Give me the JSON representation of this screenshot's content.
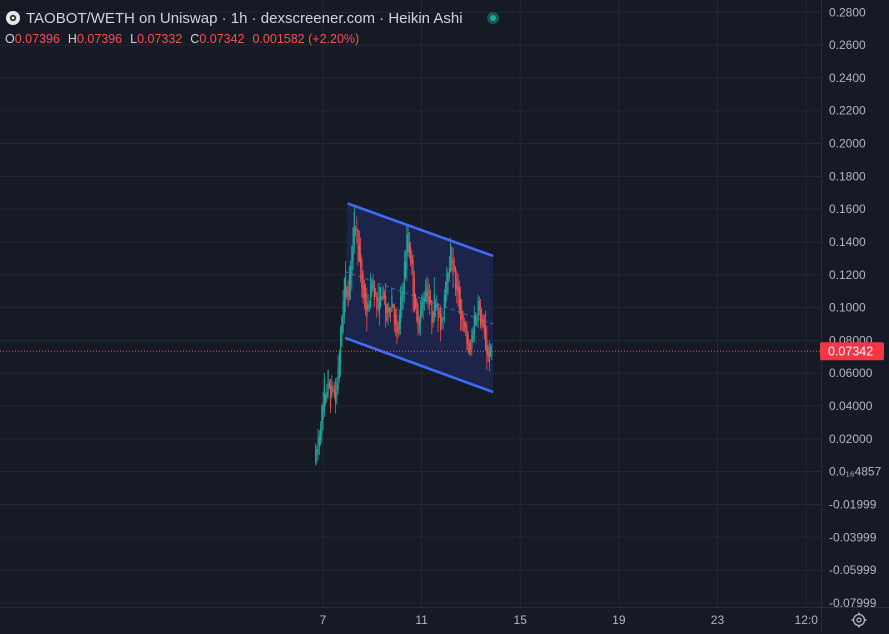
{
  "header": {
    "title": "TAOBOT/WETH on Uniswap · 1h · dexscreener.com · Heikin Ashi"
  },
  "ohlc": {
    "o_label": "O",
    "o_value": "0.07396",
    "h_label": "H",
    "h_value": "0.07396",
    "l_label": "L",
    "l_value": "0.07332",
    "c_label": "C",
    "c_value": "0.07342",
    "change": "0.001582 (+2.20%)"
  },
  "colors": {
    "background": "#161a25",
    "grid": "#232734",
    "up": "#26a69a",
    "down": "#ef5350",
    "channel_line": "#3f6bff",
    "channel_fill": "#1f2a55",
    "price_label_bg": "#f23645"
  },
  "chart_data": {
    "type": "candlestick",
    "chart_style": "Heikin Ashi",
    "y_ticks": [
      "0.2800",
      "0.2600",
      "0.2400",
      "0.2200",
      "0.2000",
      "0.1800",
      "0.1600",
      "0.1400",
      "0.1200",
      "0.1000",
      "0.08000",
      "0.06000",
      "0.04000",
      "0.02000",
      "0.0₁₆4857",
      "-0.01999",
      "-0.03999",
      "-0.05999",
      "-0.07999"
    ],
    "y_tick_values": [
      0.28,
      0.26,
      0.24,
      0.22,
      0.2,
      0.18,
      0.16,
      0.14,
      0.12,
      0.1,
      0.08,
      0.06,
      0.04,
      0.02,
      0.0,
      -0.02,
      -0.04,
      -0.06,
      -0.08
    ],
    "ylim": [
      -0.0825,
      0.2875
    ],
    "x_ticks": [
      {
        "label": "7",
        "day": 7
      },
      {
        "label": "11",
        "day": 11
      },
      {
        "label": "15",
        "day": 15
      },
      {
        "label": "19",
        "day": 19
      },
      {
        "label": "23",
        "day": 23
      },
      {
        "label": "12:0",
        "day": 26.6
      }
    ],
    "xlim_day": [
      -6.1,
      27.2
    ],
    "last_price": 0.07342,
    "last_price_label": "0.07342",
    "channel": {
      "upper": [
        [
          8.0,
          0.1635
        ],
        [
          13.9,
          0.1315
        ]
      ],
      "lower": [
        [
          7.9,
          0.0815
        ],
        [
          13.9,
          0.0485
        ]
      ],
      "mid": [
        [
          7.9,
          0.122
        ],
        [
          13.9,
          0.09
        ]
      ]
    },
    "price_path": [
      [
        6.7,
        0.006
      ],
      [
        6.8,
        0.02
      ],
      [
        6.9,
        0.031
      ],
      [
        7.0,
        0.038
      ],
      [
        7.05,
        0.05
      ],
      [
        7.12,
        0.044
      ],
      [
        7.2,
        0.058
      ],
      [
        7.3,
        0.046
      ],
      [
        7.4,
        0.054
      ],
      [
        7.5,
        0.04
      ],
      [
        7.6,
        0.063
      ],
      [
        7.72,
        0.084
      ],
      [
        7.85,
        0.118
      ],
      [
        8.0,
        0.108
      ],
      [
        8.15,
        0.135
      ],
      [
        8.3,
        0.155
      ],
      [
        8.45,
        0.128
      ],
      [
        8.6,
        0.11
      ],
      [
        8.8,
        0.095
      ],
      [
        9.0,
        0.12
      ],
      [
        9.2,
        0.098
      ],
      [
        9.4,
        0.112
      ],
      [
        9.6,
        0.092
      ],
      [
        9.8,
        0.108
      ],
      [
        10.0,
        0.078
      ],
      [
        10.25,
        0.118
      ],
      [
        10.45,
        0.146
      ],
      [
        10.6,
        0.122
      ],
      [
        10.8,
        0.088
      ],
      [
        11.0,
        0.1
      ],
      [
        11.2,
        0.116
      ],
      [
        11.4,
        0.094
      ],
      [
        11.6,
        0.108
      ],
      [
        11.8,
        0.084
      ],
      [
        12.0,
        0.124
      ],
      [
        12.2,
        0.136
      ],
      [
        12.4,
        0.11
      ],
      [
        12.6,
        0.096
      ],
      [
        12.8,
        0.082
      ],
      [
        12.95,
        0.068
      ],
      [
        13.1,
        0.092
      ],
      [
        13.3,
        0.102
      ],
      [
        13.5,
        0.085
      ],
      [
        13.7,
        0.07
      ],
      [
        13.85,
        0.0734
      ]
    ]
  }
}
